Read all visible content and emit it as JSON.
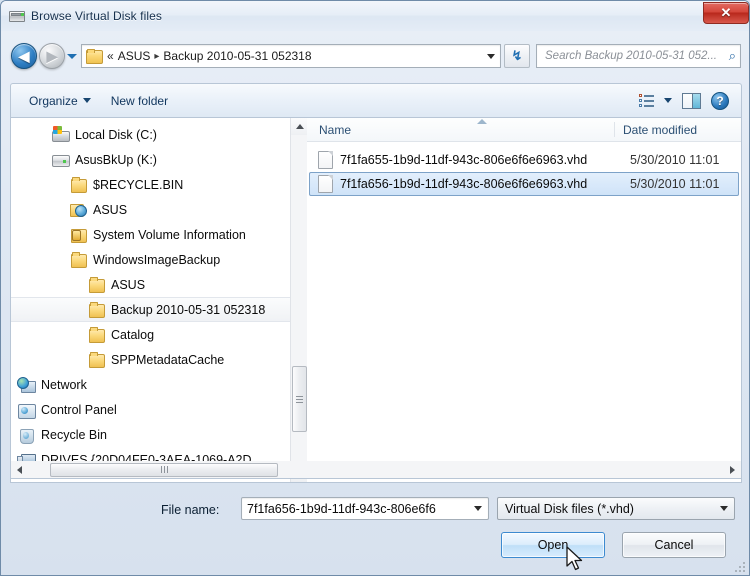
{
  "window": {
    "title": "Browse Virtual Disk files",
    "title_icon": "virtual-disk-icon",
    "close_label": "✕"
  },
  "nav": {
    "back_icon": "back-arrow-icon",
    "back_glyph": "◀",
    "forward_icon": "forward-arrow-icon",
    "forward_glyph": "▶",
    "history_icon": "chevron-down-icon",
    "refresh_icon": "refresh-icon",
    "refresh_glyph": "↯",
    "breadcrumbs": [
      {
        "label": "«"
      },
      {
        "label": "ASUS"
      },
      {
        "label": "Backup 2010-05-31 052318"
      }
    ],
    "address_dropdown_icon": "chevron-down-icon"
  },
  "search": {
    "placeholder": "Search Backup 2010-05-31 052...",
    "value": "",
    "icon": "search-icon",
    "glyph": "⌕"
  },
  "toolbar": {
    "organize_label": "Organize",
    "organize_icon": "chevron-down-icon",
    "new_folder_label": "New folder",
    "view_mode_icon": "view-mode-list-icon",
    "view_mode_dropdown_icon": "chevron-down-icon",
    "preview_pane_icon": "preview-pane-icon",
    "help_icon": "help-icon",
    "help_glyph": "?"
  },
  "tree": {
    "items": [
      {
        "label": "Local Disk (C:)",
        "icon": "windows-disk-icon",
        "indent": "ind1",
        "selected": false,
        "icon_class": "ic-diskwin"
      },
      {
        "label": "AsusBkUp (K:)",
        "icon": "drive-icon",
        "indent": "ind1",
        "selected": false,
        "icon_class": "ic-drive"
      },
      {
        "label": "$RECYCLE.BIN",
        "icon": "folder-icon",
        "indent": "ind2",
        "selected": false,
        "icon_class": "ic-folder"
      },
      {
        "label": "ASUS",
        "icon": "shared-folder-icon",
        "indent": "ind2",
        "selected": false,
        "icon_class": "ic-sharefolder"
      },
      {
        "label": "System Volume Information",
        "icon": "locked-folder-icon",
        "indent": "ind2",
        "selected": false,
        "icon_class": "ic-lockfolder"
      },
      {
        "label": "WindowsImageBackup",
        "icon": "folder-icon",
        "indent": "ind2",
        "selected": false,
        "icon_class": "ic-folder"
      },
      {
        "label": "ASUS",
        "icon": "folder-icon",
        "indent": "ind3",
        "selected": false,
        "icon_class": "ic-folder"
      },
      {
        "label": "Backup 2010-05-31 052318",
        "icon": "folder-icon",
        "indent": "ind3",
        "selected": true,
        "icon_class": "ic-folder"
      },
      {
        "label": "Catalog",
        "icon": "folder-icon",
        "indent": "ind3",
        "selected": false,
        "icon_class": "ic-folder"
      },
      {
        "label": "SPPMetadataCache",
        "icon": "folder-icon",
        "indent": "ind3",
        "selected": false,
        "icon_class": "ic-folder"
      },
      {
        "label": "Network",
        "icon": "network-icon",
        "indent": "indroot",
        "selected": false,
        "icon_class": "ic-network"
      },
      {
        "label": "Control Panel",
        "icon": "control-panel-icon",
        "indent": "indroot",
        "selected": false,
        "icon_class": "ic-cpanel"
      },
      {
        "label": "Recycle Bin",
        "icon": "recycle-bin-icon",
        "indent": "indroot",
        "selected": false,
        "icon_class": "ic-recycle"
      },
      {
        "label": "DRIVES.{20D04FE0-3AEA-1069-A2D",
        "icon": "computer-icon",
        "indent": "indroot",
        "selected": false,
        "icon_class": "ic-computer"
      }
    ],
    "scroll_up_icon": "scroll-up-arrow-icon",
    "scroll_down_icon": "scroll-down-arrow-icon"
  },
  "filelist": {
    "columns": [
      {
        "key": "name",
        "label": "Name",
        "sorted": true
      },
      {
        "key": "date",
        "label": "Date modified",
        "sorted": false
      }
    ],
    "rows": [
      {
        "name": "7f1fa655-1b9d-11df-943c-806e6f6e6963.vhd",
        "date": "5/30/2010 11:01",
        "icon": "vhd-file-icon",
        "selected": false
      },
      {
        "name": "7f1fa656-1b9d-11df-943c-806e6f6e6963.vhd",
        "date": "5/30/2010 11:01",
        "icon": "vhd-file-icon",
        "selected": true
      }
    ],
    "h_scroll_left_icon": "scroll-left-arrow-icon",
    "h_scroll_right_icon": "scroll-right-arrow-icon"
  },
  "footer": {
    "file_name_label": "File name:",
    "file_name_value": "7f1fa656-1b9d-11df-943c-806e6f6",
    "file_name_dropdown_icon": "chevron-down-icon",
    "filter_value": "Virtual Disk files (*.vhd)",
    "filter_dropdown_icon": "chevron-down-icon",
    "open_label": "Open",
    "cancel_label": "Cancel",
    "resize_grip_icon": "resize-grip-icon"
  },
  "cursor": {
    "icon": "mouse-pointer-icon"
  },
  "colors": {
    "accent": "#2b79bd",
    "selection_fill": "#cfe3f8",
    "selection_border": "#7da2c8",
    "close_red": "#c8392c",
    "folder_yellow": "#fbd97d"
  }
}
